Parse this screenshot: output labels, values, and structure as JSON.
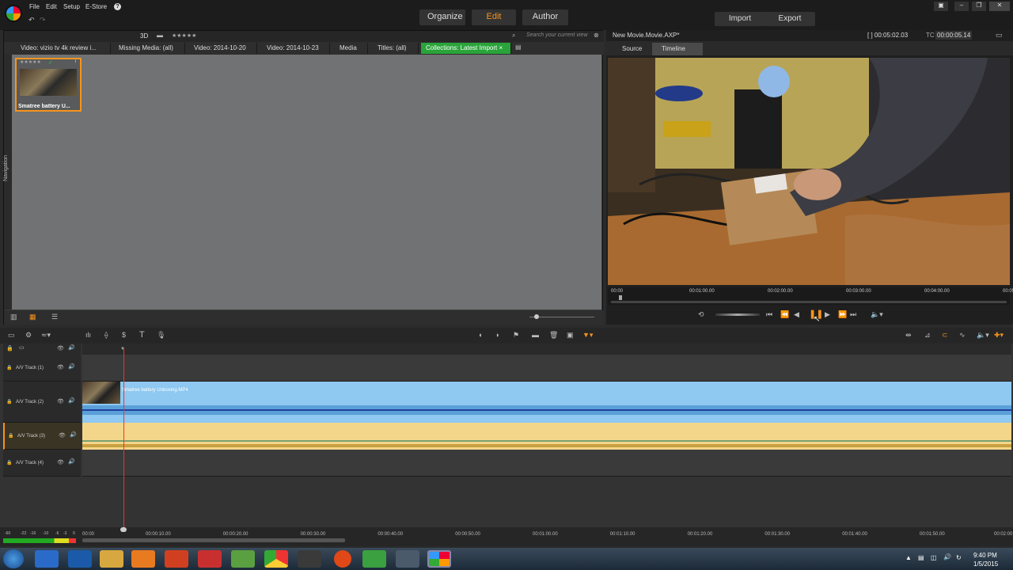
{
  "menu": {
    "file": "File",
    "edit": "Edit",
    "setup": "Setup",
    "estore": "E-Store",
    "help": "?"
  },
  "modes": {
    "organize": "Organize",
    "edit": "Edit",
    "author": "Author"
  },
  "actions": {
    "import": "Import",
    "export": "Export"
  },
  "library": {
    "view_3d": "3D",
    "stars": "★★★★★",
    "search_placeholder": "Search your current view",
    "tabs": [
      "Video: vizio tv 4k review i...",
      "Missing Media: (all)",
      "Video: 2014-10-20",
      "Video: 2014-10-23",
      "Media",
      "Titles: (all)",
      "Collections: Latest Import"
    ],
    "nav_label": "Navigation",
    "thumb_label": "Smatree battery U...",
    "thumb_stars": "★★★★★"
  },
  "preview": {
    "title": "New Movie.Movie.AXP*",
    "duration": "[ ] 00:05:02.03",
    "tc_label": "TC",
    "timecode": "00:00:05.14",
    "tabs": {
      "source": "Source",
      "timeline": "Timeline"
    },
    "ruler_ticks": [
      "00:00",
      "00:01:00.00",
      "00:02:00.00",
      "00:03:00.00",
      "00:04:00.00",
      "00:05:0"
    ]
  },
  "tracks": [
    {
      "name": "A/V Track (1)"
    },
    {
      "name": "A/V Track (2)"
    },
    {
      "name": "A/V Track (3)"
    },
    {
      "name": "A/V Track (4)"
    }
  ],
  "clip": {
    "name": "Smatree battery Unboxing.MP4"
  },
  "timeline_ruler": {
    "meter": [
      "-60",
      "-22",
      "-16",
      "-10",
      "-6",
      "-3",
      "0"
    ],
    "ticks": [
      "00:00",
      "00:00:10.00",
      "00:00:20.00",
      "00:00:30.00",
      "00:00:40.00",
      "00:00:50.00",
      "00:01:00.00",
      "00:01:10.00",
      "00:01:20.00",
      "00:01:30.00",
      "00:01:40.00",
      "00:01:50.00",
      "00:02:00"
    ]
  },
  "tray": {
    "time": "9:40 PM",
    "date": "1/5/2015"
  },
  "colors": {
    "accent": "#f7941d",
    "green_tab": "#2aa43a",
    "video_clip": "#8fc8f0",
    "audio_clip": "#f4d68a",
    "playhead": "#ee3333"
  }
}
